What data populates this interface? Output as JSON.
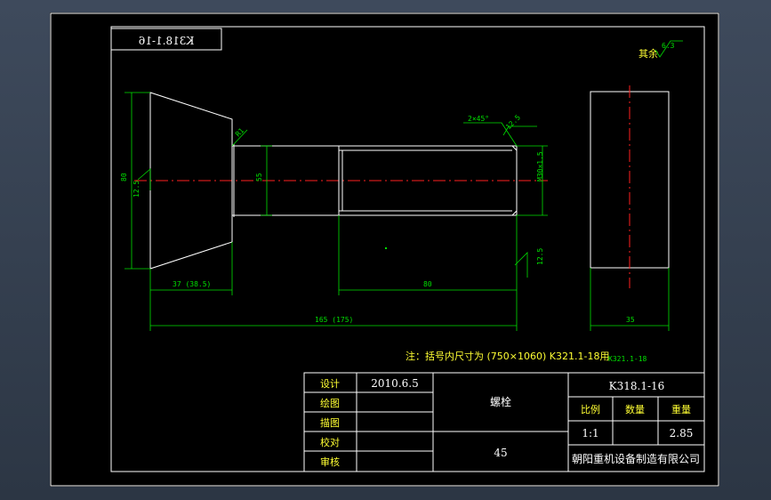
{
  "drawing": {
    "title_stamp": "K318.1-16",
    "roughness_label": "其余",
    "roughness_value": "6.3",
    "chamfer_label": "2×45°",
    "surface_r1": "12.5",
    "surface_r2": "12.5",
    "surface_r3": "12.5",
    "radius_label": "R1",
    "dim_head_dia": "80",
    "dim_shank_dia": "55",
    "dim_thread": "M30×1.5",
    "dim_head_len": "37 (38.5)",
    "dim_thread_len": "80",
    "dim_total_len": "165 (175)",
    "dim_side_width": "35",
    "note": "注：括号内尺寸为 (750×1060) K321.1-18用",
    "alt_part_no": "K321.1-18"
  },
  "title_block": {
    "design_label": "设计",
    "design_date": "2010.6.5",
    "draw_label": "绘图",
    "trace_label": "描图",
    "check_label": "校对",
    "review_label": "审核",
    "part_name": "螺栓",
    "material": "45",
    "drawing_no": "K318.1-16",
    "scale_label": "比例",
    "qty_label": "数量",
    "weight_label": "重量",
    "scale_value": "1:1",
    "qty_value": "",
    "weight_value": "2.85",
    "company": "朝阳重机设备制造有限公司"
  }
}
